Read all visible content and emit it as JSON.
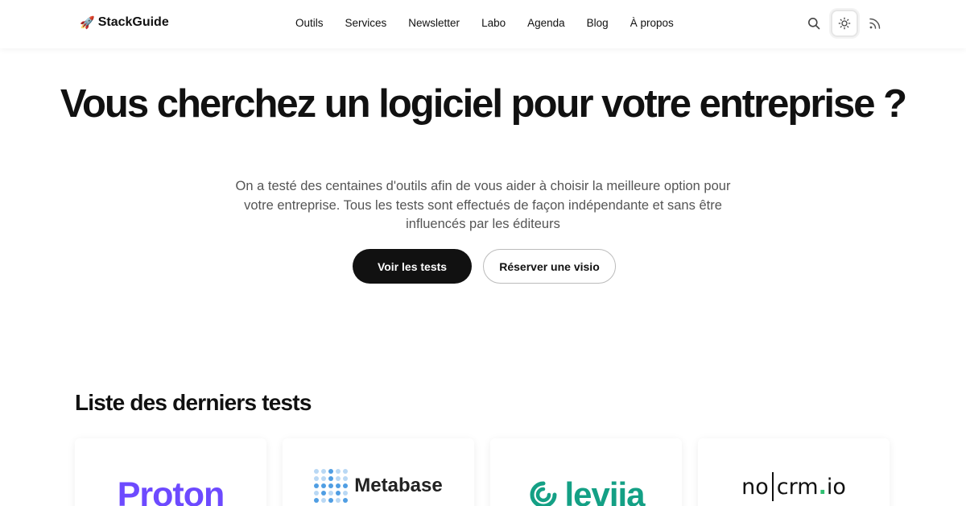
{
  "header": {
    "logo_emoji": "🚀",
    "logo_text": "StackGuide",
    "nav": [
      "Outils",
      "Services",
      "Newsletter",
      "Labo",
      "Agenda",
      "Blog",
      "À propos"
    ],
    "icons": [
      "search-icon",
      "sun-icon",
      "rss-icon"
    ]
  },
  "hero": {
    "title": "Vous cherchez un logiciel pour votre entreprise ?",
    "subtitle": "On a testé des centaines d'outils afin de vous aider à choisir la meilleure option pour votre entreprise. Tous les tests sont effectués de façon indépendante et sans être influencés par les éditeurs",
    "primary_button": "Voir les tests",
    "secondary_button": "Réserver une visio"
  },
  "tests": {
    "title": "Liste des derniers tests",
    "cards": [
      {
        "name": "Proton",
        "color": "#6d4aff"
      },
      {
        "name": "Metabase",
        "color": "#509ee3"
      },
      {
        "name": "leviia",
        "color": "#14a085"
      },
      {
        "name_parts": [
          "no",
          "crm",
          ".",
          "io"
        ],
        "accent": "#2fbf71"
      }
    ]
  }
}
